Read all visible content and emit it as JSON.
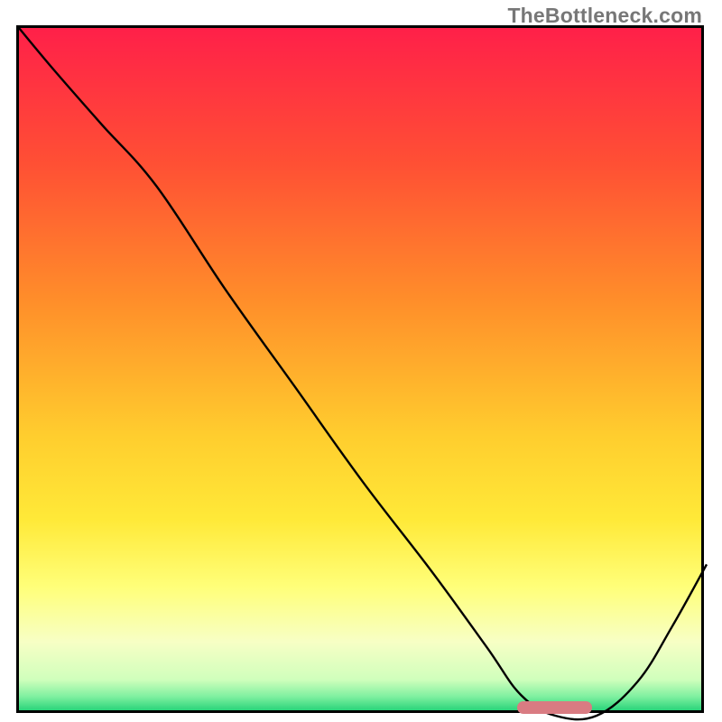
{
  "watermark": "TheBottleneck.com",
  "colors": {
    "border": "#000000",
    "curve": "#000000",
    "marker": "#d97b82",
    "gradient_stops": [
      {
        "offset": 0.0,
        "color": "#ff2049"
      },
      {
        "offset": 0.2,
        "color": "#ff5034"
      },
      {
        "offset": 0.4,
        "color": "#ff8e2a"
      },
      {
        "offset": 0.6,
        "color": "#ffce2e"
      },
      {
        "offset": 0.72,
        "color": "#ffe938"
      },
      {
        "offset": 0.82,
        "color": "#ffff7a"
      },
      {
        "offset": 0.9,
        "color": "#f7ffc5"
      },
      {
        "offset": 0.955,
        "color": "#d0ffbc"
      },
      {
        "offset": 0.98,
        "color": "#7ff0a0"
      },
      {
        "offset": 1.0,
        "color": "#2ad47a"
      }
    ]
  },
  "chart_data": {
    "type": "line",
    "title": "",
    "xlabel": "",
    "ylabel": "",
    "xlim": [
      0,
      100
    ],
    "ylim": [
      0,
      100
    ],
    "series": [
      {
        "name": "bottleneck-curve",
        "x": [
          0,
          5,
          12,
          20,
          30,
          40,
          50,
          60,
          68,
          73,
          78,
          84,
          90,
          95,
          100
        ],
        "y": [
          100,
          94,
          86,
          77,
          62,
          48,
          34,
          21,
          10,
          3,
          0,
          0,
          5,
          13,
          22
        ]
      }
    ],
    "annotations": [
      {
        "name": "optimal-marker",
        "x_start": 73,
        "x_end": 84,
        "y": 0
      }
    ]
  }
}
